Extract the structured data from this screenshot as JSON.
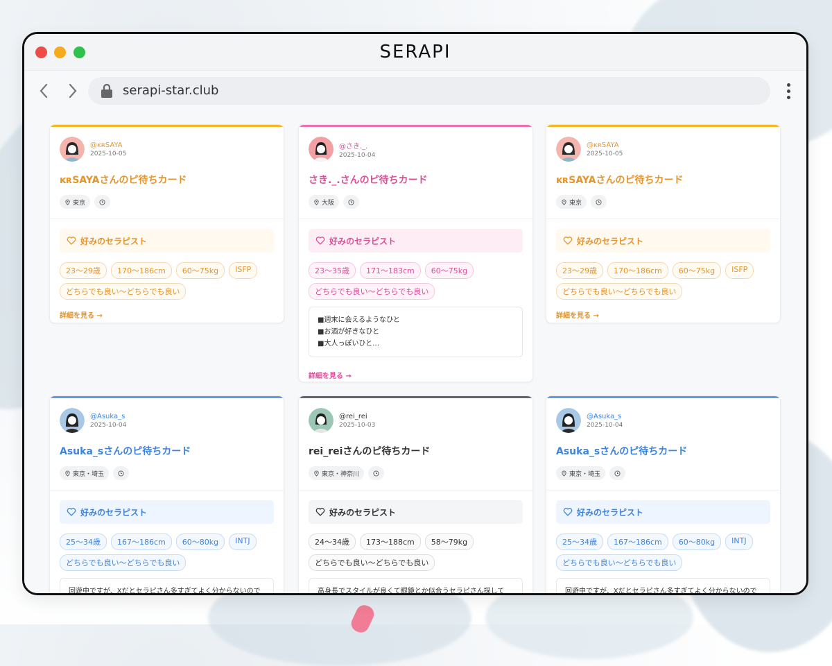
{
  "window": {
    "app_title": "SERAPI",
    "url": "serapi-star.club"
  },
  "cards": [
    {
      "handle": "@ᴋʀSAYA",
      "date": "2025-10-05",
      "title": "ᴋʀSAYAさんのピ待ちカード",
      "location": "東京",
      "pref_label": "好みのセラピスト",
      "tags": [
        "23〜29歳",
        "170〜186cm",
        "60〜75kg",
        "ISFP",
        "どちらでも良い〜どちらでも良い"
      ],
      "detail": "詳細を見る →"
    },
    {
      "handle": "@さき._.",
      "date": "2025-10-04",
      "title": "さき._.さんのピ待ちカード",
      "location": "大阪",
      "pref_label": "好みのセラピスト",
      "tags": [
        "23〜35歳",
        "171〜183cm",
        "60〜75kg",
        "どちらでも良い〜どちらでも良い"
      ],
      "note": [
        "■週末に会えるようなひと",
        "■お酒が好きなひと",
        "■大人っぽいひと…"
      ],
      "detail": "詳細を見る →"
    },
    {
      "handle": "@ᴋʀSAYA",
      "date": "2025-10-05",
      "title": "ᴋʀSAYAさんのピ待ちカード",
      "location": "東京",
      "pref_label": "好みのセラピスト",
      "tags": [
        "23〜29歳",
        "170〜186cm",
        "60〜75kg",
        "ISFP",
        "どちらでも良い〜どちらでも良い"
      ],
      "detail": "詳細を見る →"
    },
    {
      "handle": "@Asuka_s",
      "date": "2025-10-04",
      "title": "Asuka_sさんのピ待ちカード",
      "location": "東京・埼玉",
      "pref_label": "好みのセラピスト",
      "tags": [
        "25〜34歳",
        "167〜186cm",
        "60〜80kg",
        "INTJ",
        "どちらでも良い〜どちらでも良い"
      ],
      "note": [
        "回遊中ですが、Xだとセラピさん多すぎてよく分からないので"
      ]
    },
    {
      "handle": "@rei_rei",
      "date": "2025-10-03",
      "title": "rei_reiさんのピ待ちカード",
      "location": "東京・神奈川",
      "pref_label": "好みのセラピスト",
      "tags": [
        "24〜34歳",
        "173〜188cm",
        "58〜79kg",
        "どちらでも良い〜どちらでも良い"
      ],
      "note": [
        "高身長でスタイルが良くて眼鏡とか似合うセラピさん探して"
      ]
    },
    {
      "handle": "@Asuka_s",
      "date": "2025-10-04",
      "title": "Asuka_sさんのピ待ちカード",
      "location": "東京・埼玉",
      "pref_label": "好みのセラピスト",
      "tags": [
        "25〜34歳",
        "167〜186cm",
        "60〜80kg",
        "INTJ",
        "どちらでも良い〜どちらでも良い"
      ],
      "note": [
        "回遊中ですが、Xだとセラピさん多すぎてよく分からないので"
      ]
    }
  ],
  "colors": {
    "orange": "#e4952b",
    "pink": "#dd4e9a",
    "blue": "#3f83db",
    "gray": "#333333"
  }
}
